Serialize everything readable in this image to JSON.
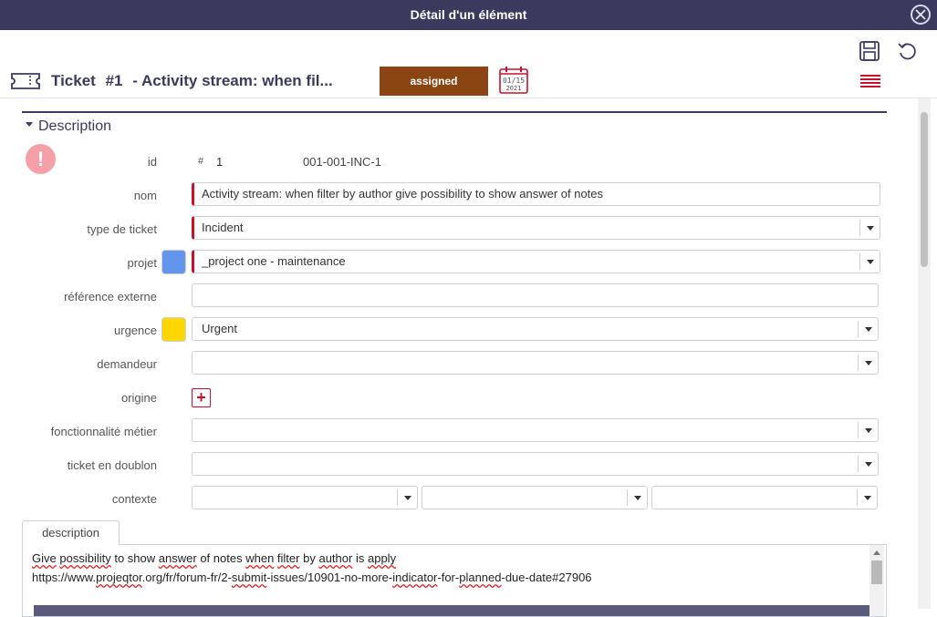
{
  "window": {
    "title": "Détail d'un élément"
  },
  "header": {
    "type_label": "Ticket",
    "number": "#1",
    "title": "- Activity stream: when fil...",
    "status": "assigned",
    "calendar_date_line1": "01/15",
    "calendar_date_line2": "2021"
  },
  "section": {
    "title": "Description"
  },
  "fields": {
    "id": {
      "label": "id",
      "hash": "#",
      "value": "1",
      "reference": "001-001-INC-1"
    },
    "nom": {
      "label": "nom",
      "value": "Activity stream: when filter by author give possibility to show answer of notes"
    },
    "type": {
      "label": "type de ticket",
      "value": "Incident"
    },
    "projet": {
      "label": "projet",
      "value": "_project one - maintenance",
      "color": "#6495ed"
    },
    "ref_externe": {
      "label": "référence externe",
      "value": ""
    },
    "urgence": {
      "label": "urgence",
      "value": "Urgent",
      "color": "#ffd700"
    },
    "demandeur": {
      "label": "demandeur",
      "value": ""
    },
    "origine": {
      "label": "origine",
      "add_symbol": "+"
    },
    "fonctionnalite": {
      "label": "fonctionnalité métier",
      "value": ""
    },
    "doublon": {
      "label": "ticket en doublon",
      "value": ""
    },
    "contexte": {
      "label": "contexte",
      "values": [
        "",
        "",
        ""
      ]
    }
  },
  "description": {
    "tab_label": "description",
    "line1_words": [
      "Give",
      "possibility",
      "to show",
      "answer",
      "of notes",
      "when",
      "filter",
      "by",
      "author",
      "is",
      "apply"
    ],
    "line2_parts": [
      "https://www.",
      "projeqtor",
      ".org/fr/forum-fr/2-",
      "submit",
      "-issues/10901-no-more-",
      "indicator",
      "-for-",
      "planned",
      "-due-date#27906"
    ]
  }
}
